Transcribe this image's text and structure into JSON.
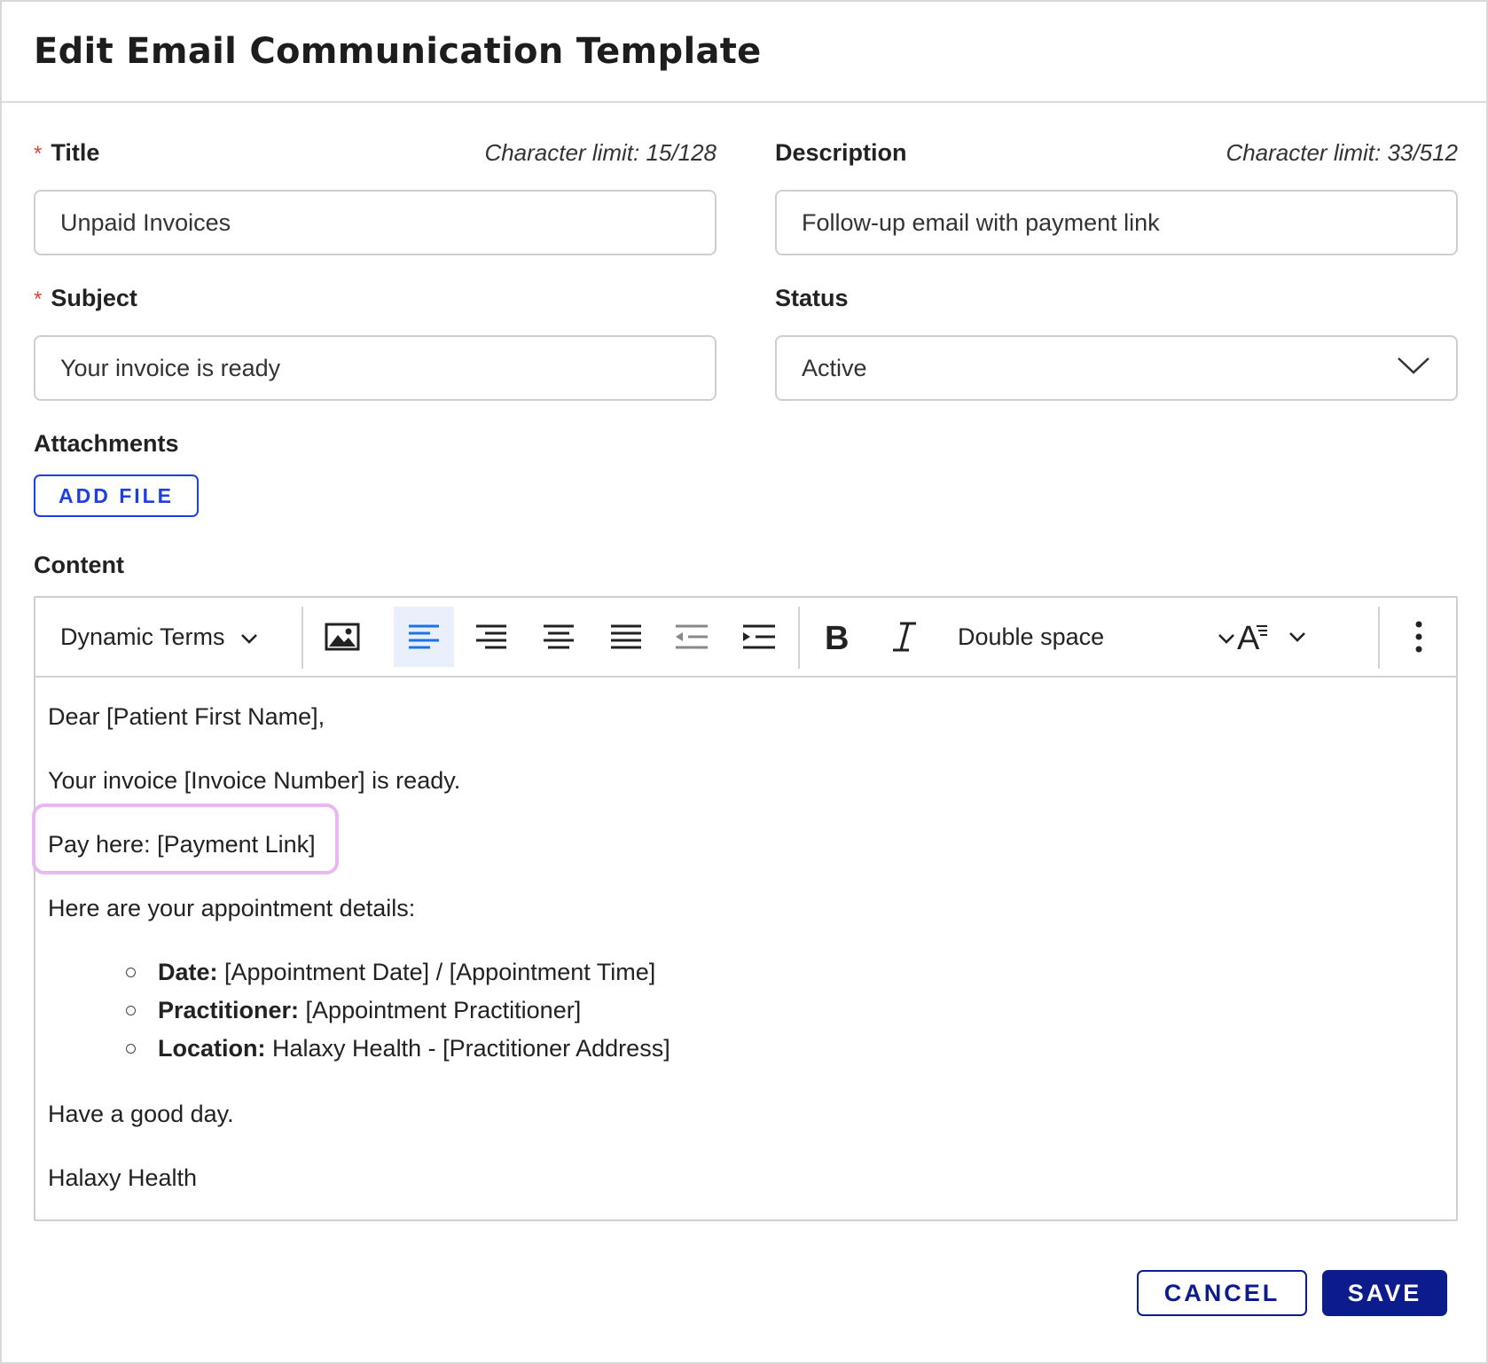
{
  "header": {
    "title": "Edit Email Communication Template"
  },
  "form": {
    "title": {
      "label": "Title",
      "required_mark": "*",
      "limit": "Character limit: 15/128",
      "value": "Unpaid Invoices"
    },
    "description": {
      "label": "Description",
      "limit": "Character limit: 33/512",
      "value": "Follow-up email with payment link"
    },
    "subject": {
      "label": "Subject",
      "required_mark": "*",
      "value": "Your invoice is ready"
    },
    "status": {
      "label": "Status",
      "value": "Active"
    },
    "attachments": {
      "label": "Attachments",
      "button": "ADD FILE"
    },
    "content": {
      "label": "Content"
    }
  },
  "toolbar": {
    "dynamic_terms": "Dynamic Terms",
    "spacing": "Double space",
    "icons": [
      "image-icon",
      "align-left-icon",
      "align-right-icon",
      "align-center-icon",
      "align-justify-icon",
      "outdent-icon",
      "indent-icon",
      "bold-icon",
      "italic-icon",
      "text-style-icon",
      "more-icon"
    ],
    "active_alignment": "left",
    "active_color": "#1a73e8"
  },
  "editor": {
    "greeting": "Dear [Patient First Name],",
    "invoice_line": "Your invoice [Invoice Number] is ready.",
    "pay_line": "Pay here: [Payment Link]",
    "details_intro": "Here are your appointment details:",
    "details": [
      {
        "label": "Date:",
        "value": " [Appointment Date] / [Appointment Time]"
      },
      {
        "label": "Practitioner:",
        "value": " [Appointment Practitioner]"
      },
      {
        "label": "Location:",
        "value": " Halaxy Health - [Practitioner Address]"
      }
    ],
    "closing": "Have a good day.",
    "signature": "Halaxy Health"
  },
  "footer": {
    "cancel": "CANCEL",
    "save": "SAVE"
  },
  "colors": {
    "primary": "#0d1c8c",
    "link_blue": "#1f3ee0",
    "required": "#d8463b",
    "highlight": "#e8b8f0"
  }
}
